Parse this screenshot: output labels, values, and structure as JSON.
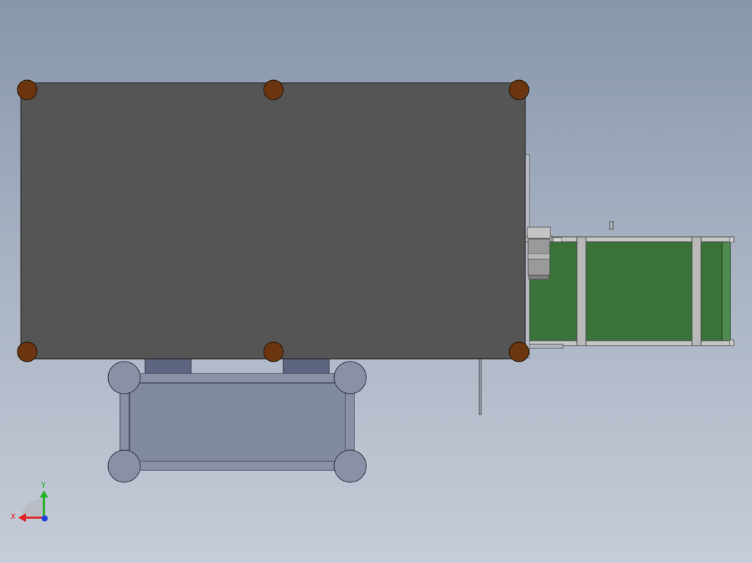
{
  "colors": {
    "background_top": "#8796ab",
    "background_bottom": "#c6ccd8",
    "table_top": "#555555",
    "table_outline": "#2a2a2a",
    "corner_post": "#6b3510",
    "lower_frame": "#8088a0",
    "lower_frame_edge": "#4a4f60",
    "conveyor_belt": "#3a733a",
    "conveyor_rail": "#c6c6c6",
    "motor": "#9a9a9a",
    "axis_x": "#e02020",
    "axis_y": "#20b020",
    "axis_z": "#2040e0"
  },
  "view_triad": {
    "x_label": "X",
    "y_label": "Y",
    "icon": "coordinate-triad-icon"
  }
}
